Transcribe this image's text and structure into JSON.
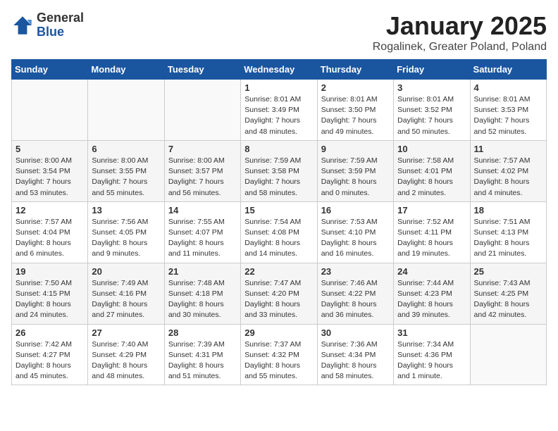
{
  "header": {
    "logo_general": "General",
    "logo_blue": "Blue",
    "month_title": "January 2025",
    "location": "Rogalinek, Greater Poland, Poland"
  },
  "weekdays": [
    "Sunday",
    "Monday",
    "Tuesday",
    "Wednesday",
    "Thursday",
    "Friday",
    "Saturday"
  ],
  "weeks": [
    [
      {
        "day": "",
        "info": ""
      },
      {
        "day": "",
        "info": ""
      },
      {
        "day": "",
        "info": ""
      },
      {
        "day": "1",
        "info": "Sunrise: 8:01 AM\nSunset: 3:49 PM\nDaylight: 7 hours and 48 minutes."
      },
      {
        "day": "2",
        "info": "Sunrise: 8:01 AM\nSunset: 3:50 PM\nDaylight: 7 hours and 49 minutes."
      },
      {
        "day": "3",
        "info": "Sunrise: 8:01 AM\nSunset: 3:52 PM\nDaylight: 7 hours and 50 minutes."
      },
      {
        "day": "4",
        "info": "Sunrise: 8:01 AM\nSunset: 3:53 PM\nDaylight: 7 hours and 52 minutes."
      }
    ],
    [
      {
        "day": "5",
        "info": "Sunrise: 8:00 AM\nSunset: 3:54 PM\nDaylight: 7 hours and 53 minutes."
      },
      {
        "day": "6",
        "info": "Sunrise: 8:00 AM\nSunset: 3:55 PM\nDaylight: 7 hours and 55 minutes."
      },
      {
        "day": "7",
        "info": "Sunrise: 8:00 AM\nSunset: 3:57 PM\nDaylight: 7 hours and 56 minutes."
      },
      {
        "day": "8",
        "info": "Sunrise: 7:59 AM\nSunset: 3:58 PM\nDaylight: 7 hours and 58 minutes."
      },
      {
        "day": "9",
        "info": "Sunrise: 7:59 AM\nSunset: 3:59 PM\nDaylight: 8 hours and 0 minutes."
      },
      {
        "day": "10",
        "info": "Sunrise: 7:58 AM\nSunset: 4:01 PM\nDaylight: 8 hours and 2 minutes."
      },
      {
        "day": "11",
        "info": "Sunrise: 7:57 AM\nSunset: 4:02 PM\nDaylight: 8 hours and 4 minutes."
      }
    ],
    [
      {
        "day": "12",
        "info": "Sunrise: 7:57 AM\nSunset: 4:04 PM\nDaylight: 8 hours and 6 minutes."
      },
      {
        "day": "13",
        "info": "Sunrise: 7:56 AM\nSunset: 4:05 PM\nDaylight: 8 hours and 9 minutes."
      },
      {
        "day": "14",
        "info": "Sunrise: 7:55 AM\nSunset: 4:07 PM\nDaylight: 8 hours and 11 minutes."
      },
      {
        "day": "15",
        "info": "Sunrise: 7:54 AM\nSunset: 4:08 PM\nDaylight: 8 hours and 14 minutes."
      },
      {
        "day": "16",
        "info": "Sunrise: 7:53 AM\nSunset: 4:10 PM\nDaylight: 8 hours and 16 minutes."
      },
      {
        "day": "17",
        "info": "Sunrise: 7:52 AM\nSunset: 4:11 PM\nDaylight: 8 hours and 19 minutes."
      },
      {
        "day": "18",
        "info": "Sunrise: 7:51 AM\nSunset: 4:13 PM\nDaylight: 8 hours and 21 minutes."
      }
    ],
    [
      {
        "day": "19",
        "info": "Sunrise: 7:50 AM\nSunset: 4:15 PM\nDaylight: 8 hours and 24 minutes."
      },
      {
        "day": "20",
        "info": "Sunrise: 7:49 AM\nSunset: 4:16 PM\nDaylight: 8 hours and 27 minutes."
      },
      {
        "day": "21",
        "info": "Sunrise: 7:48 AM\nSunset: 4:18 PM\nDaylight: 8 hours and 30 minutes."
      },
      {
        "day": "22",
        "info": "Sunrise: 7:47 AM\nSunset: 4:20 PM\nDaylight: 8 hours and 33 minutes."
      },
      {
        "day": "23",
        "info": "Sunrise: 7:46 AM\nSunset: 4:22 PM\nDaylight: 8 hours and 36 minutes."
      },
      {
        "day": "24",
        "info": "Sunrise: 7:44 AM\nSunset: 4:23 PM\nDaylight: 8 hours and 39 minutes."
      },
      {
        "day": "25",
        "info": "Sunrise: 7:43 AM\nSunset: 4:25 PM\nDaylight: 8 hours and 42 minutes."
      }
    ],
    [
      {
        "day": "26",
        "info": "Sunrise: 7:42 AM\nSunset: 4:27 PM\nDaylight: 8 hours and 45 minutes."
      },
      {
        "day": "27",
        "info": "Sunrise: 7:40 AM\nSunset: 4:29 PM\nDaylight: 8 hours and 48 minutes."
      },
      {
        "day": "28",
        "info": "Sunrise: 7:39 AM\nSunset: 4:31 PM\nDaylight: 8 hours and 51 minutes."
      },
      {
        "day": "29",
        "info": "Sunrise: 7:37 AM\nSunset: 4:32 PM\nDaylight: 8 hours and 55 minutes."
      },
      {
        "day": "30",
        "info": "Sunrise: 7:36 AM\nSunset: 4:34 PM\nDaylight: 8 hours and 58 minutes."
      },
      {
        "day": "31",
        "info": "Sunrise: 7:34 AM\nSunset: 4:36 PM\nDaylight: 9 hours and 1 minute."
      },
      {
        "day": "",
        "info": ""
      }
    ]
  ]
}
